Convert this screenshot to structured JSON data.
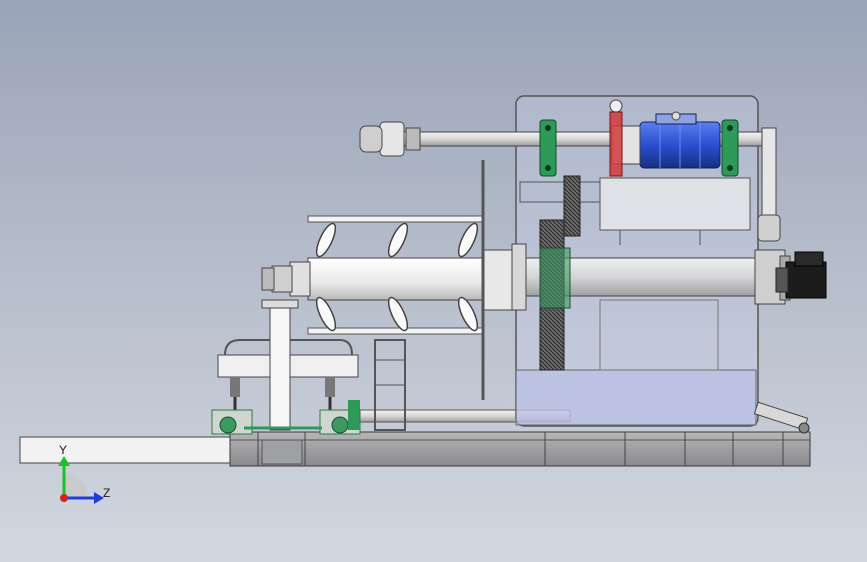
{
  "view": {
    "background_top": "#9aa4b8",
    "background_bottom": "#d2d7df"
  },
  "triad": {
    "y_label": "Y",
    "z_label": "Z",
    "y_color": "#1fbf2a",
    "z_color": "#1f3fd8",
    "origin_color": "#d82020"
  },
  "colors": {
    "motor_blue": "#2a4fd0",
    "bearing_green": "#2e9a5a",
    "red_part": "#d23a3a",
    "servo_black": "#1c1c1c",
    "frame_grey": "#8e8e92",
    "glass_tint": "#c9cde8"
  }
}
